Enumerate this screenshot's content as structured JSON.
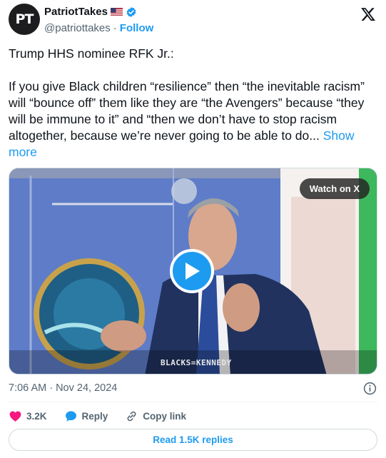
{
  "author": {
    "avatar_text": "PT",
    "name": "PatriotTakes",
    "handle": "@patriottakes",
    "separator": "·",
    "follow_label": "Follow"
  },
  "tweet": {
    "line1": "Trump HHS nominee RFK Jr.:",
    "body": "If you give Black children “resilience” then “the inevitable racism” will “bounce off” them like they are “the Avengers” because “they will be immune to it” and “then we don’t have to stop racism altogether, because we’re never going to be able to do...",
    "show_more": "Show more"
  },
  "media": {
    "watch_label": "Watch on X",
    "watermark": "BLACKS=KENNEDY"
  },
  "timestamp": "7:06 AM · Nov 24, 2024",
  "actions": {
    "likes": "3.2K",
    "reply_label": "Reply",
    "copy_label": "Copy link"
  },
  "read_replies_label": "Read 1.5K replies",
  "colors": {
    "accent": "#1d9bf0",
    "like": "#f91880",
    "muted": "#536471"
  }
}
